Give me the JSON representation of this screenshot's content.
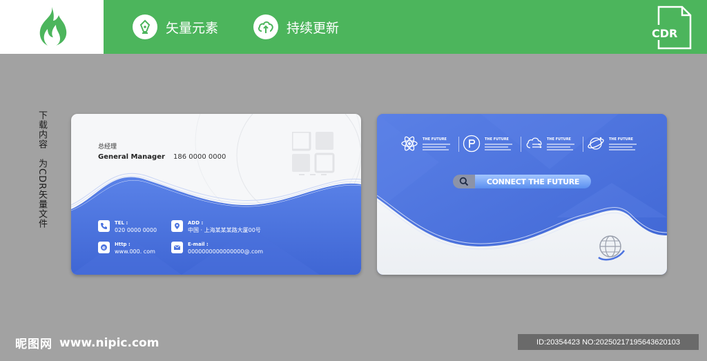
{
  "header": {
    "features": [
      {
        "icon": "pen-nib-icon",
        "label": "矢量元素"
      },
      {
        "icon": "cloud-upload-icon",
        "label": "持续更新"
      }
    ],
    "file_badge": "CDR"
  },
  "side_text": "下载内容　为CDR矢量文件",
  "front_card": {
    "title_cn": "总经理",
    "title_en": "General Manager",
    "phone": "186 0000 0000",
    "contacts": [
      {
        "label": "TEL :",
        "value": "020 0000 0000"
      },
      {
        "label": "ADD :",
        "value": "中国 · 上海某某某路大厦00号"
      },
      {
        "label": "Http :",
        "value": "www.000. com"
      },
      {
        "label": "E-mail :",
        "value": "0000000000000000@.com"
      }
    ]
  },
  "back_card": {
    "features": [
      {
        "icon": "atom-icon",
        "title": "THE FUTURE"
      },
      {
        "icon": "p-logo-icon",
        "title": "THE FUTURE"
      },
      {
        "icon": "cloud-circuit-icon",
        "title": "THE FUTURE"
      },
      {
        "icon": "planet-icon",
        "title": "THE FUTURE"
      }
    ],
    "search_label": "CONNECT THE FUTURE"
  },
  "footer": {
    "brand": "昵图网",
    "url": "www.nipic.com",
    "id_text": "ID:20354423 NO:20250217195643620103"
  },
  "colors": {
    "header_green": "#4cb55c",
    "card_blue": "#4d74df",
    "background_gray": "#a2a2a2"
  }
}
